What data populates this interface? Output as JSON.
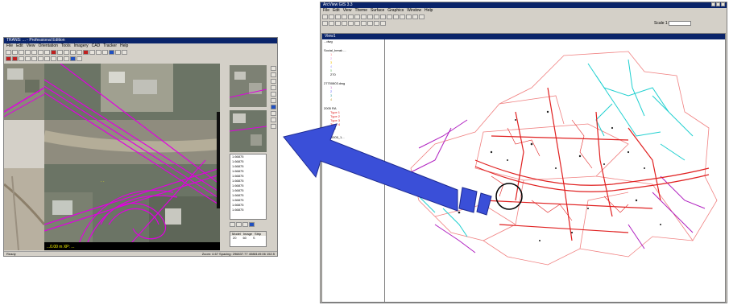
{
  "arcview": {
    "title": "ArcView GIS 3.3",
    "menu": [
      "File",
      "Edit",
      "View",
      "Theme",
      "Surface",
      "Graphics",
      "Window",
      "Help"
    ],
    "scale_label": "Scale 1:",
    "view_title": "View1",
    "legend": [
      {
        "label": "...dwg"
      },
      {
        "label": "Social_break ...",
        "sub": [
          "1",
          "2",
          "3",
          "4",
          "5",
          "270"
        ]
      },
      {
        "label": "27700803.dwg",
        "sub": [
          "1",
          "2",
          "3",
          "4"
        ]
      },
      {
        "label": "2005 RA",
        "sub": [
          "Type 1",
          "Type 2",
          "Type 3",
          "Type 4",
          "100"
        ]
      },
      {
        "label": "27700005_1..."
      }
    ]
  },
  "editor": {
    "title": "TRANS: ... - Professional Edition",
    "menu": [
      "File",
      "Edit",
      "View",
      "Orientation",
      "Tools",
      "Imagery",
      "CAD",
      "Tracker",
      "Help"
    ],
    "coord_readout": "...0.00 m XP: ...",
    "status_left": "Ready",
    "status_right": "Zoom: 4.67  Spacing: 296837.77  4088149.06  152.5",
    "list_values": [
      "1.66875",
      "1.66875",
      "1.66875",
      "1.66875",
      "1.66875",
      "1.66875",
      "1.66875",
      "1.66875",
      "1.66875",
      "1.66875",
      "1.66875",
      "1.66875"
    ],
    "grid_headers": [
      "Model",
      "Image",
      "Strip"
    ],
    "grid_values": [
      "20",
      "60",
      "S"
    ]
  },
  "colors": {
    "arrow": "#3a4fd8",
    "highlight_circle": "#000000",
    "road_magenta": "#e000e0",
    "map_red": "#e02020",
    "map_cyan": "#20d0d0",
    "map_purple": "#b020c0"
  }
}
